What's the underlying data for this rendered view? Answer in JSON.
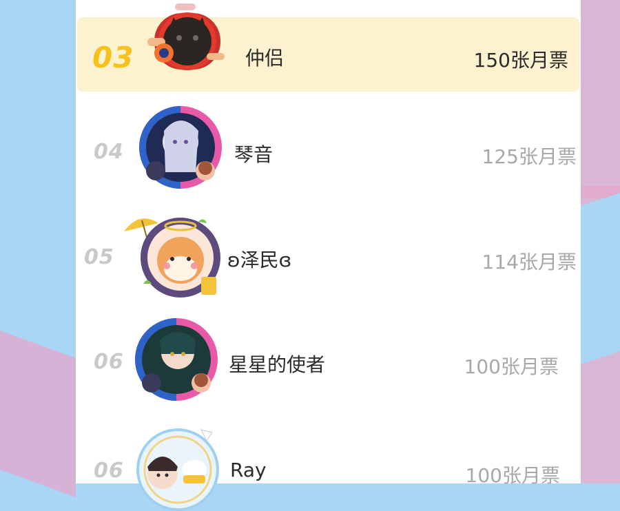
{
  "ranking": {
    "rows": [
      {
        "rank": "03",
        "name": "仲侣",
        "votes": "150张月票",
        "highlight": true
      },
      {
        "rank": "04",
        "name": "琴音",
        "votes": "125张月票"
      },
      {
        "rank": "05",
        "name": "ʚ泽民ɞ",
        "votes": "114张月票"
      },
      {
        "rank": "06",
        "name": "星星的使者",
        "votes": "100张月票"
      },
      {
        "rank": "06",
        "name": "Ray",
        "votes": "100张月票"
      }
    ]
  },
  "colors": {
    "highlight_bg": "#fdf2cf",
    "gold_rank": "#f5c21b",
    "grey_rank": "#c9c9c9",
    "vote_grey": "#a8a8a8",
    "bg_blue": "#a9d6f5",
    "bg_pink": "#d8b6d6"
  }
}
